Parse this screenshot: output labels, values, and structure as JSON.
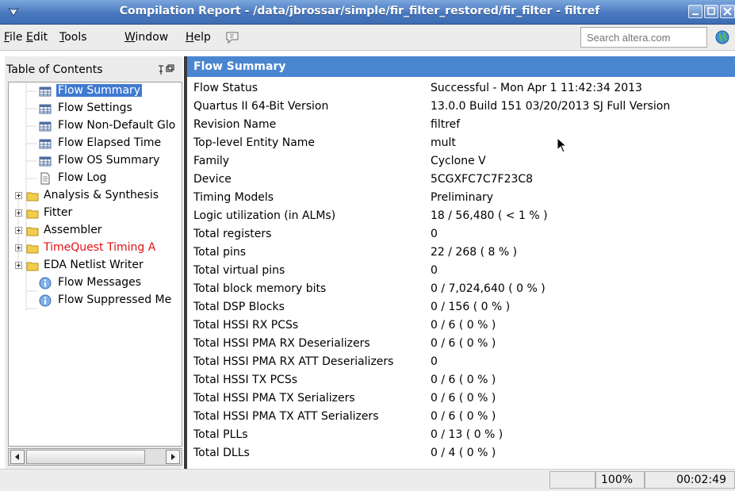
{
  "window": {
    "title": "Compilation Report - /data/jbrossar/simple/fir_filter_restored/fir_filter - filtref"
  },
  "menu": {
    "items": [
      {
        "underline": "F",
        "rest": "ile"
      },
      {
        "underline": "E",
        "rest": "dit"
      },
      {
        "underline": "T",
        "rest": "ools"
      },
      {
        "underline": "W",
        "rest": "indow"
      },
      {
        "underline": "H",
        "rest": "elp"
      }
    ],
    "search_placeholder": "Search altera.com"
  },
  "toc": {
    "title": "Table of Contents",
    "items": [
      {
        "label": "Flow Summary",
        "icon": "table-icon"
      },
      {
        "label": "Flow Settings",
        "icon": "table-icon"
      },
      {
        "label": "Flow Non-Default Glo",
        "icon": "table-icon"
      },
      {
        "label": "Flow Elapsed Time",
        "icon": "table-icon"
      },
      {
        "label": "Flow OS Summary",
        "icon": "table-icon"
      },
      {
        "label": "Flow Log",
        "icon": "document-icon"
      },
      {
        "label": "Analysis & Synthesis",
        "icon": "folder-icon"
      },
      {
        "label": "Fitter",
        "icon": "folder-icon"
      },
      {
        "label": "Assembler",
        "icon": "folder-icon"
      },
      {
        "label": "TimeQuest Timing A",
        "icon": "folder-icon"
      },
      {
        "label": "EDA Netlist Writer",
        "icon": "folder-icon"
      },
      {
        "label": "Flow Messages",
        "icon": "info-icon"
      },
      {
        "label": "Flow Suppressed Me",
        "icon": "info-icon"
      }
    ],
    "selected_index": 0
  },
  "summary": {
    "header": "Flow Summary",
    "rows": [
      {
        "key": "Flow Status",
        "value": "Successful - Mon Apr  1 11:42:34 2013"
      },
      {
        "key": "Quartus II 64-Bit Version",
        "value": "13.0.0 Build 151 03/20/2013 SJ Full Version"
      },
      {
        "key": "Revision Name",
        "value": "filtref"
      },
      {
        "key": "Top-level Entity Name",
        "value": "mult"
      },
      {
        "key": "Family",
        "value": "Cyclone V"
      },
      {
        "key": "Device",
        "value": "5CGXFC7C7F23C8"
      },
      {
        "key": "Timing Models",
        "value": "Preliminary"
      },
      {
        "key": "Logic utilization (in ALMs)",
        "value": "18 / 56,480 ( < 1 % )"
      },
      {
        "key": "Total registers",
        "value": "0"
      },
      {
        "key": "Total pins",
        "value": "22 / 268 ( 8 % )"
      },
      {
        "key": "Total virtual pins",
        "value": "0"
      },
      {
        "key": "Total block memory bits",
        "value": "0 / 7,024,640 ( 0 % )"
      },
      {
        "key": "Total DSP Blocks",
        "value": "0 / 156 ( 0 % )"
      },
      {
        "key": "Total HSSI RX PCSs",
        "value": "0 / 6 ( 0 % )"
      },
      {
        "key": "Total HSSI PMA RX Deserializers",
        "value": "0 / 6 ( 0 % )"
      },
      {
        "key": "Total HSSI PMA RX ATT Deserializers",
        "value": "0"
      },
      {
        "key": "Total HSSI TX PCSs",
        "value": "0 / 6 ( 0 % )"
      },
      {
        "key": "Total HSSI PMA TX Serializers",
        "value": "0 / 6 ( 0 % )"
      },
      {
        "key": "Total HSSI PMA TX ATT Serializers",
        "value": "0 / 6 ( 0 % )"
      },
      {
        "key": "Total PLLs",
        "value": "0 / 13 ( 0 % )"
      },
      {
        "key": "Total DLLs",
        "value": "0 / 4 ( 0 % )"
      }
    ]
  },
  "status": {
    "zoom": "100%",
    "elapsed": "00:02:49"
  },
  "colors": {
    "title_bar": "#4a79bf",
    "section_header": "#4a86d0",
    "selection": "#3f7ad1",
    "error_text": "#e01010"
  }
}
